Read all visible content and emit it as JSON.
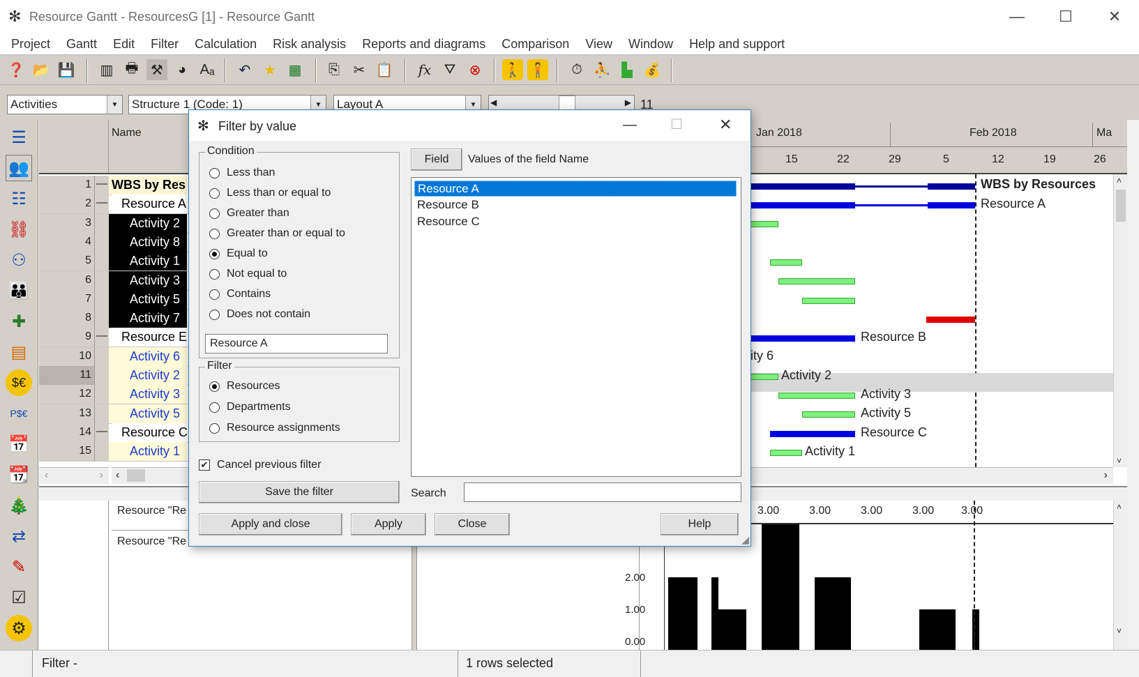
{
  "window": {
    "title": "Resource Gantt - ResourcesG [1] - Resource Gantt"
  },
  "menu": [
    "Project",
    "Gantt",
    "Edit",
    "Filter",
    "Calculation",
    "Risk analysis",
    "Reports and diagrams",
    "Comparison",
    "View",
    "Window",
    "Help and support"
  ],
  "selectors": {
    "view": "Activities",
    "structure": "Structure 1 (Code: 1)",
    "layout": "Layout A",
    "counter": "11"
  },
  "grid": {
    "header_name": "Name",
    "rows": [
      {
        "num": "1",
        "exp": "—",
        "name": "WBS by Res"
      },
      {
        "num": "2",
        "exp": "—",
        "name": "Resource A"
      },
      {
        "num": "3",
        "exp": "",
        "name": "Activity 2"
      },
      {
        "num": "4",
        "exp": "",
        "name": "Activity 8"
      },
      {
        "num": "5",
        "exp": "",
        "name": "Activity 1"
      },
      {
        "num": "6",
        "exp": "",
        "name": "Activity 3"
      },
      {
        "num": "7",
        "exp": "",
        "name": "Activity 5"
      },
      {
        "num": "8",
        "exp": "",
        "name": "Activity 7"
      },
      {
        "num": "9",
        "exp": "—",
        "name": "Resource E"
      },
      {
        "num": "10",
        "exp": "",
        "name": "Activity 6"
      },
      {
        "num": "11",
        "exp": "",
        "name": "Activity 2"
      },
      {
        "num": "12",
        "exp": "",
        "name": "Activity 3"
      },
      {
        "num": "13",
        "exp": "",
        "name": "Activity 5"
      },
      {
        "num": "14",
        "exp": "—",
        "name": "Resource C"
      },
      {
        "num": "15",
        "exp": "",
        "name": "Activity 1"
      }
    ]
  },
  "gantt": {
    "months": [
      "Jan 2018",
      "Feb 2018",
      "Ma"
    ],
    "days": [
      "15",
      "22",
      "29",
      "5",
      "12",
      "19",
      "26"
    ],
    "labels": [
      "WBS by Resources",
      "Resource A",
      "Resource B",
      "ity 6",
      "Activity 2",
      "Activity 3",
      "Activity 5",
      "Resource C",
      "Activity 1"
    ]
  },
  "lower": {
    "row1": "Resource \"Re",
    "row2": "Resource \"Re",
    "values": [
      "00",
      "3.00",
      "3.00",
      "3.00",
      "3.00",
      "3.00"
    ],
    "yticks": [
      "2.00",
      "1.00",
      "0.00"
    ]
  },
  "status": {
    "filter": "Filter -",
    "selected": "1 rows selected"
  },
  "dialog": {
    "title": "Filter by value",
    "condition_legend": "Condition",
    "conditions": [
      "Less than",
      "Less than or equal to",
      "Greater than",
      "Greater than or equal to",
      "Equal to",
      "Not equal to",
      "Contains",
      "Does not contain"
    ],
    "selected_condition": "Equal to",
    "value": "Resource A",
    "filter_legend": "Filter",
    "filter_options": [
      "Resources",
      "Departments",
      "Resource assignments"
    ],
    "selected_filter": "Resources",
    "cancel_previous": "Cancel previous filter",
    "save_filter": "Save the filter",
    "field_button": "Field",
    "field_caption": "Values of the field  Name",
    "values": [
      "Resource A",
      "Resource B",
      "Resource C"
    ],
    "search_label": "Search",
    "search_value": "",
    "buttons": {
      "apply_close": "Apply and close",
      "apply": "Apply",
      "close": "Close",
      "help": "Help"
    }
  }
}
